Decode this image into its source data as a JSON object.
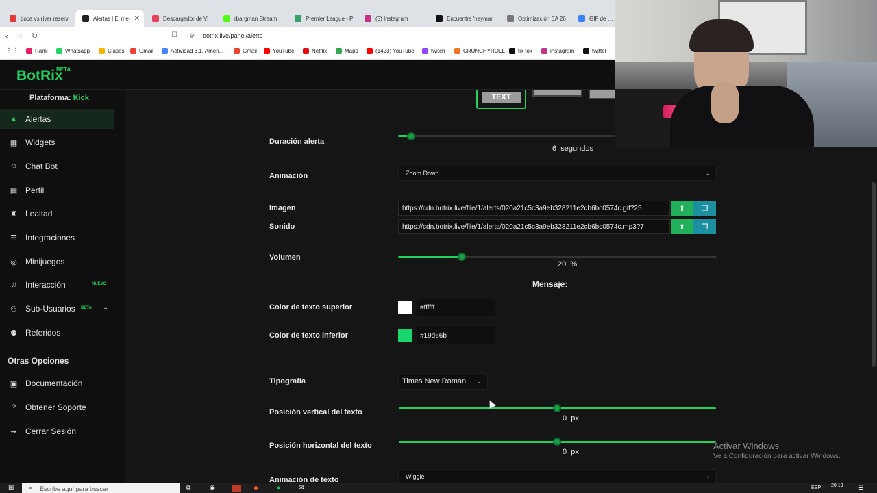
{
  "browser": {
    "tabs": [
      {
        "label": "boca vs river reserv",
        "color": "#e03a3a"
      },
      {
        "label": "Alertas | El mej",
        "color": "#222222",
        "active": true
      },
      {
        "label": "Descargador de Vi",
        "color": "#e5405e"
      },
      {
        "label": "rbargman Stream",
        "color": "#53fc18"
      },
      {
        "label": "Premier League - P",
        "color": "#38a169"
      },
      {
        "label": "(5) Instagram",
        "color": "#c13584"
      },
      {
        "label": "Encuentra 'neymar",
        "color": "#111111"
      },
      {
        "label": "Optimización EA 26",
        "color": "#777777"
      },
      {
        "label": "GIF de Cent",
        "color": "#3b82f6"
      }
    ],
    "url": "botrix.live/panel/alerts",
    "bookmarks": [
      {
        "label": "Rami",
        "color": "#e91e63"
      },
      {
        "label": "Whatsapp",
        "color": "#25d366"
      },
      {
        "label": "Clases",
        "color": "#f4b400"
      },
      {
        "label": "Gmail",
        "color": "#ea4335"
      },
      {
        "label": "Actividad 3.1. Améri...",
        "color": "#4285f4"
      },
      {
        "label": "Gmail",
        "color": "#ea4335"
      },
      {
        "label": "YouTube",
        "color": "#ff0000"
      },
      {
        "label": "Netflix",
        "color": "#e50914"
      },
      {
        "label": "Maps",
        "color": "#34a853"
      },
      {
        "label": "(1423) YouTube",
        "color": "#ff0000"
      },
      {
        "label": "twitch",
        "color": "#9146ff"
      },
      {
        "label": "CRUNCHYROLL",
        "color": "#f47521"
      },
      {
        "label": "tik tok",
        "color": "#111111"
      },
      {
        "label": "instagram",
        "color": "#c13584"
      },
      {
        "label": "twitter",
        "color": "#111111"
      }
    ]
  },
  "app": {
    "logo": "BotRix",
    "logo_badge": "BETA",
    "platform_label": "Plataforma:",
    "platform_value": "Kick"
  },
  "sidebar": {
    "items": [
      {
        "label": "Alertas",
        "icon": "warning-icon",
        "active": true
      },
      {
        "label": "Widgets",
        "icon": "grid-icon"
      },
      {
        "label": "Chat Bot",
        "icon": "robot-icon"
      },
      {
        "label": "Perfil",
        "icon": "id-card-icon"
      },
      {
        "label": "Lealtad",
        "icon": "trophy-icon"
      },
      {
        "label": "Integraciones",
        "icon": "list-icon"
      },
      {
        "label": "Minijuegos",
        "icon": "gamepad-icon"
      },
      {
        "label": "Interacción",
        "icon": "music-icon",
        "badge": "NUEVO"
      },
      {
        "label": "Sub-Usuarios",
        "icon": "users-icon",
        "badge": "BETA"
      },
      {
        "label": "Referidos",
        "icon": "user-group-icon"
      }
    ],
    "section_title": "Otras Opciones",
    "other_items": [
      {
        "label": "Documentación",
        "icon": "doc-icon"
      },
      {
        "label": "Obtener Soporte",
        "icon": "help-icon"
      },
      {
        "label": "Cerrar Sesión",
        "icon": "logout-icon"
      }
    ]
  },
  "form": {
    "layout_option": "TEXT",
    "duration_label": "Duración alerta",
    "duration_value": "6",
    "duration_unit": "segundos",
    "duration_fraction": 0.04,
    "animation_label": "Animación",
    "animation_value": "Zoom Down",
    "image_label": "Imagen",
    "image_url": "https://cdn.botrix.live/file/1/alerts/020a21c5c3a9eb328211e2cb6bc0574c.gif?25",
    "sound_label": "Sonido",
    "sound_url": "https://cdn.botrix.live/file/1/alerts/020a21c5c3a9eb328211e2cb6bc0574c.mp3?7",
    "volume_label": "Volumen",
    "volume_value": "20",
    "volume_unit": "%",
    "volume_fraction": 0.2,
    "message_header": "Mensaje:",
    "top_color_label": "Color de texto superior",
    "top_color": "#ffffff",
    "bottom_color_label": "Color de texto inferior",
    "bottom_color": "#19d66b",
    "font_label": "Tipografía",
    "font_value": "Times New Roman",
    "vpos_label": "Posición vertical del texto",
    "vpos_value": "0",
    "vpos_unit": "px",
    "hpos_label": "Posición horizontal del texto",
    "hpos_value": "0",
    "hpos_unit": "px",
    "text_anim_label": "Animación de texto",
    "text_anim_value": "Wiggle"
  },
  "windows": {
    "activate_title": "Activar Windows",
    "activate_sub": "Ve a Configuración para activar Windows.",
    "search_placeholder": "Escribe aquí para buscar",
    "clock": "20:19",
    "lang": "ESP"
  },
  "colors": {
    "accent": "#23d160",
    "upload_button": "#23b05a",
    "gallery_button": "#1c8fa1",
    "background": "#151515",
    "sidebar": "#0f0f0f"
  }
}
